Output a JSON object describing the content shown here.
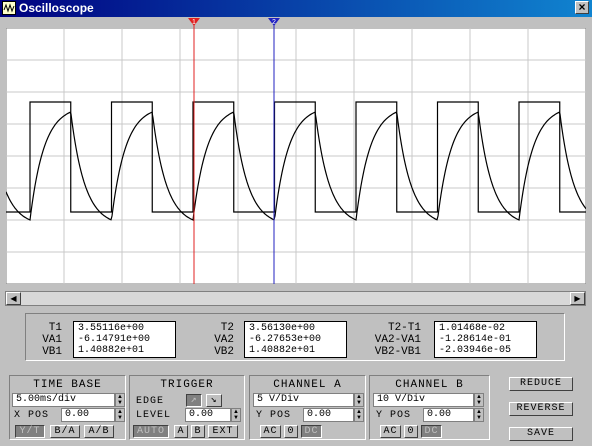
{
  "window": {
    "title": "Oscilloscope"
  },
  "cursors": {
    "t1_label": "1",
    "t2_label": "2"
  },
  "readouts": {
    "left": {
      "rows": [
        {
          "label": "T1",
          "value": "3.55116e+00"
        },
        {
          "label": "VA1",
          "value": "-6.14791e+00"
        },
        {
          "label": "VB1",
          "value": "1.40882e+01"
        }
      ]
    },
    "mid": {
      "rows": [
        {
          "label": "T2",
          "value": "3.56130e+00"
        },
        {
          "label": "VA2",
          "value": "-6.27653e+00"
        },
        {
          "label": "VB2",
          "value": "1.40882e+01"
        }
      ]
    },
    "right": {
      "rows": [
        {
          "label": "T2-T1",
          "value": "1.01468e-02"
        },
        {
          "label": "VA2-VA1",
          "value": "-1.28614e-01"
        },
        {
          "label": "VB2-VB1",
          "value": "-2.03946e-05"
        }
      ]
    }
  },
  "timebase": {
    "title": "TIME BASE",
    "value": "5.00ms/div",
    "xpos_label": "X POS",
    "xpos_value": "0.00",
    "buttons": [
      "Y/T",
      "B/A",
      "A/B"
    ]
  },
  "trigger": {
    "title": "TRIGGER",
    "edge_label": "EDGE",
    "level_label": "LEVEL",
    "level_value": "0.00",
    "buttons": [
      "AUTO",
      "A",
      "B",
      "EXT"
    ]
  },
  "channel_a": {
    "title": "CHANNEL A",
    "value": "5 V/Div",
    "ypos_label": "Y POS",
    "ypos_value": "0.00",
    "buttons": [
      "AC",
      "0",
      "DC"
    ]
  },
  "channel_b": {
    "title": "CHANNEL B",
    "value": "10 V/Div",
    "ypos_label": "Y POS",
    "ypos_value": "0.00",
    "buttons": [
      "AC",
      "0",
      "DC"
    ]
  },
  "side_buttons": {
    "reduce": "REDUCE",
    "reverse": "REVERSE",
    "save": "SAVE"
  },
  "colors": {
    "titlebar": "#000080",
    "cursor1": "#e02020",
    "cursor2": "#2020c0",
    "grid": "#c8c8c8"
  }
}
